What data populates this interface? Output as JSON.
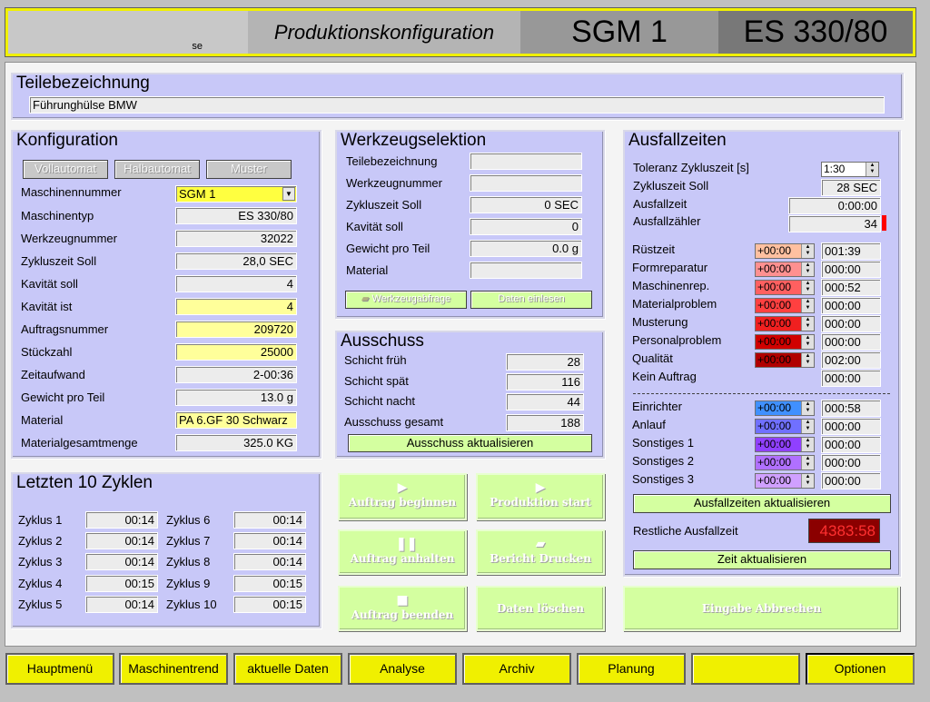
{
  "header": {
    "user": "se",
    "title": "Produktionskonfiguration",
    "machine": "SGM 1",
    "model": "ES 330/80"
  },
  "teil": {
    "title": "Teilebezeichnung",
    "value": "Führunghülse BMW"
  },
  "konfig": {
    "title": "Konfiguration",
    "modes": [
      "Vollautomat",
      "Halbautomat",
      "Muster"
    ],
    "rows": [
      {
        "label": "Maschinennummer",
        "value": "SGM 1"
      },
      {
        "label": "Maschinentyp",
        "value": "ES 330/80"
      },
      {
        "label": "Werkzeugnummer",
        "value": "32022"
      },
      {
        "label": "Zykluszeit Soll",
        "value": "28,0 SEC"
      },
      {
        "label": "Kavität soll",
        "value": "4"
      },
      {
        "label": "Kavität ist",
        "value": "4"
      },
      {
        "label": "Auftragsnummer",
        "value": "209720"
      },
      {
        "label": "Stückzahl",
        "value": "25000"
      },
      {
        "label": "Zeitaufwand",
        "value": "2-00:36"
      },
      {
        "label": "Gewicht pro Teil",
        "value": "13.0 g"
      },
      {
        "label": "Material",
        "value": "PA 6.GF 30 Schwarz"
      },
      {
        "label": "Materialgesamtmenge",
        "value": "325.0 KG"
      }
    ]
  },
  "werkzeug": {
    "title": "Werkzeugselektion",
    "rows": [
      {
        "label": "Teilebezeichnung",
        "value": ""
      },
      {
        "label": "Werkzeugnummer",
        "value": ""
      },
      {
        "label": "Zykluszeit Soll",
        "value": "0 SEC"
      },
      {
        "label": "Kavität soll",
        "value": "0"
      },
      {
        "label": "Gewicht pro Teil",
        "value": "0.0 g"
      },
      {
        "label": "Material",
        "value": ""
      }
    ],
    "btn_abfrage": "Werkzeugabfrage",
    "btn_einlesen": "Daten einlesen"
  },
  "ausschuss": {
    "title": "Ausschuss",
    "rows": [
      {
        "label": "Schicht früh",
        "value": "28"
      },
      {
        "label": "Schicht spät",
        "value": "116"
      },
      {
        "label": "Schicht nacht",
        "value": "44"
      },
      {
        "label": "Ausschuss gesamt",
        "value": "188"
      }
    ],
    "btn": "Ausschuss aktualisieren"
  },
  "zyklen": {
    "title": "Letzten 10 Zyklen",
    "items": [
      {
        "label": "Zyklus 1",
        "value": "00:14"
      },
      {
        "label": "Zyklus 2",
        "value": "00:14"
      },
      {
        "label": "Zyklus 3",
        "value": "00:14"
      },
      {
        "label": "Zyklus 4",
        "value": "00:15"
      },
      {
        "label": "Zyklus 5",
        "value": "00:14"
      },
      {
        "label": "Zyklus 6",
        "value": "00:14"
      },
      {
        "label": "Zyklus 7",
        "value": "00:14"
      },
      {
        "label": "Zyklus 8",
        "value": "00:14"
      },
      {
        "label": "Zyklus 9",
        "value": "00:15"
      },
      {
        "label": "Zyklus 10",
        "value": "00:15"
      }
    ]
  },
  "actions": {
    "auftrag_beginnen": "Auftrag beginnen",
    "produktion_start": "Produktion start",
    "auftrag_anhalten": "Auftrag anhalten",
    "bericht_drucken": "Bericht Drucken",
    "auftrag_beenden": "Auftrag beenden",
    "daten_loeschen": "Daten löschen",
    "eingabe_abbrechen": "Eingabe Abbrechen"
  },
  "ausfall": {
    "title": "Ausfallzeiten",
    "toleranz_label": "Toleranz Zykluszeit [s]",
    "toleranz_value": "1:30",
    "zyklus_label": "Zykluszeit Soll",
    "zyklus_value": "28 SEC",
    "ausfallzeit_label": "Ausfallzeit",
    "ausfallzeit_value": "0:00:00",
    "zaehler_label": "Ausfallzähler",
    "zaehler_value": "34",
    "causes": [
      {
        "label": "Rüstzeit",
        "adj": "+00:00",
        "value": "001:39",
        "color": "#ffc0a0"
      },
      {
        "label": "Formreparatur",
        "adj": "+00:00",
        "value": "000:00",
        "color": "#ff9090"
      },
      {
        "label": "Maschinenrep.",
        "adj": "+00:00",
        "value": "000:52",
        "color": "#ff6060"
      },
      {
        "label": "Materialproblem",
        "adj": "+00:00",
        "value": "000:00",
        "color": "#ff4040"
      },
      {
        "label": "Musterung",
        "adj": "+00:00",
        "value": "000:00",
        "color": "#f02020"
      },
      {
        "label": "Personalproblem",
        "adj": "+00:00",
        "value": "000:00",
        "color": "#d00000"
      },
      {
        "label": "Qualität",
        "adj": "+00:00",
        "value": "002:00",
        "color": "#b00000"
      },
      {
        "label": "Kein Auftrag",
        "adj": "",
        "value": "000:00",
        "color": ""
      }
    ],
    "causes2": [
      {
        "label": "Einrichter",
        "adj": "+00:00",
        "value": "000:58",
        "color": "#4090ff"
      },
      {
        "label": "Anlauf",
        "adj": "+00:00",
        "value": "000:00",
        "color": "#7070ff"
      },
      {
        "label": "Sonstiges 1",
        "adj": "+00:00",
        "value": "000:00",
        "color": "#9040ff"
      },
      {
        "label": "Sonstiges 2",
        "adj": "+00:00",
        "value": "000:00",
        "color": "#b070ff"
      },
      {
        "label": "Sonstiges 3",
        "adj": "+00:00",
        "value": "000:00",
        "color": "#d0a0ff"
      }
    ],
    "btn_aktualisieren": "Ausfallzeiten aktualisieren",
    "rest_label": "Restliche Ausfallzeit",
    "rest_value": "4383:58",
    "btn_zeit": "Zeit aktualisieren"
  },
  "footer": [
    "Hauptmenü",
    "Maschinentrend",
    "aktuelle Daten",
    "Analyse",
    "Archiv",
    "Planung",
    "",
    "Optionen"
  ]
}
